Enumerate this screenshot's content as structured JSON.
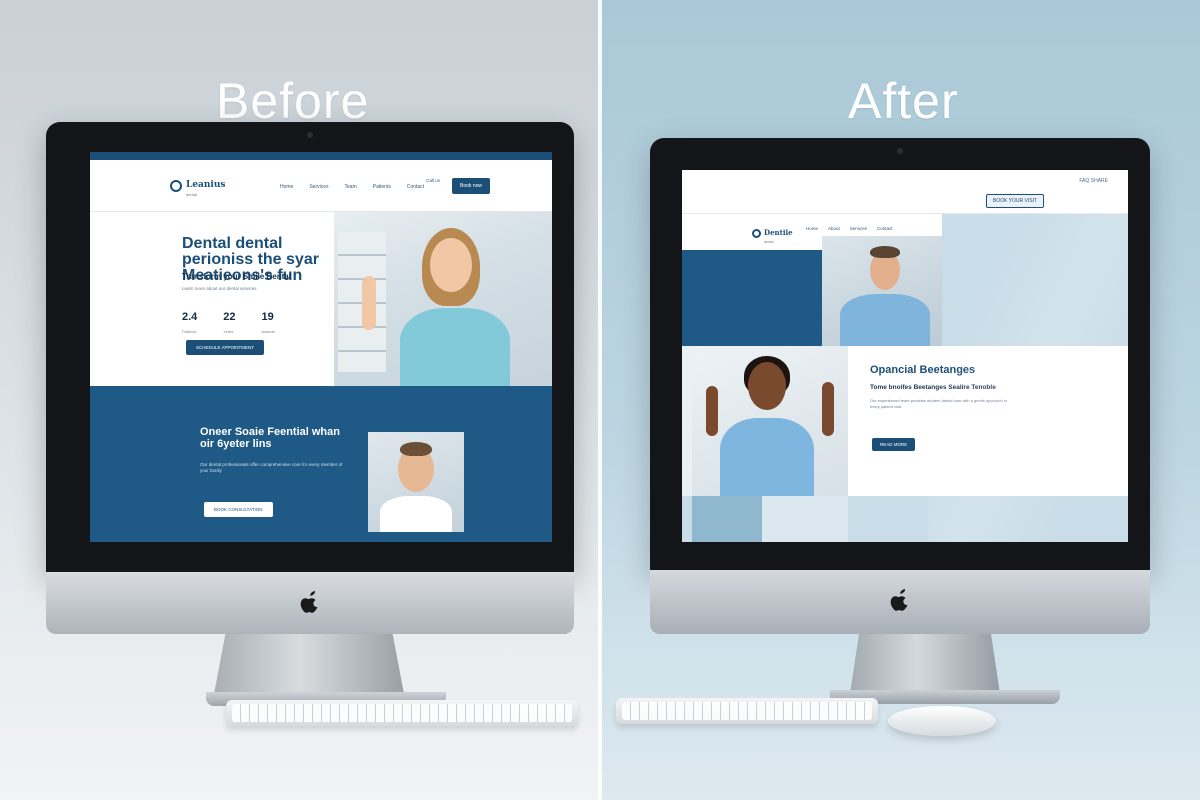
{
  "captions": {
    "before": "Before",
    "after": "After"
  },
  "before_site": {
    "brand": {
      "name": "Leanius",
      "tagline": "dental"
    },
    "nav": [
      "Home",
      "Services",
      "Team",
      "Patients",
      "Contact"
    ],
    "contact_text": "Call us",
    "cta": "Book now",
    "hero": {
      "headline": "Dental dental perioniss the syar Meatieons's fun",
      "subheadline": "Transform your Smile Dental",
      "body": "Learn more about our dental services",
      "stats": [
        {
          "value": "2.4",
          "label": "Patients"
        },
        {
          "value": "22",
          "label": "Years"
        },
        {
          "value": "19",
          "label": "Awards"
        }
      ],
      "button": "SCHEDULE APPOINTMENT"
    },
    "band": {
      "headline": "Oneer Soaie Feential whan oir 6yeter lins",
      "body": "Our dental professionals offer comprehensive care for every member of your family",
      "button": "BOOK CONSULTATION"
    }
  },
  "after_site": {
    "brand": {
      "name": "Dentile",
      "tagline": "dental"
    },
    "nav": [
      "Home",
      "About",
      "Services",
      "Contact"
    ],
    "top_right": "FAQ  SHARE",
    "cta": "BOOK YOUR VISIT",
    "feature": {
      "headline": "Opancial Beetanges",
      "subheadline": "Tome bnoifes Beetanges Sealire Tenoble",
      "body": "Our experienced team provides modern dental care with a gentle approach to every patient visit.",
      "button": "READ MORE"
    }
  },
  "colors": {
    "brand_blue": "#1e5a85",
    "light_blue": "#c9dde8",
    "scrub": "#7fc3d6"
  }
}
